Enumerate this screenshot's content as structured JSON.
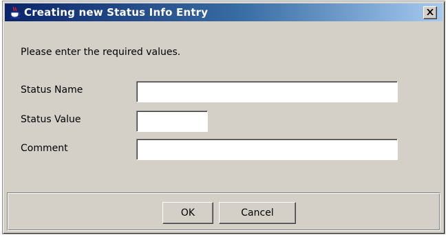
{
  "window": {
    "title": "Creating new Status Info Entry",
    "close_symbol": "✕"
  },
  "icons": {
    "app": "java-coffee-cup-icon",
    "close": "close-icon"
  },
  "dialog": {
    "instructions": "Please enter the required values."
  },
  "form": {
    "status_name": {
      "label": "Status Name",
      "value": ""
    },
    "status_value": {
      "label": "Status Value",
      "value": ""
    },
    "comment": {
      "label": "Comment",
      "value": ""
    }
  },
  "buttons": {
    "ok_label": "OK",
    "cancel_label": "Cancel"
  },
  "colors": {
    "titlebar_start": "#0a246a",
    "titlebar_end": "#a6caf0",
    "dialog_background": "#d4d0c8"
  }
}
